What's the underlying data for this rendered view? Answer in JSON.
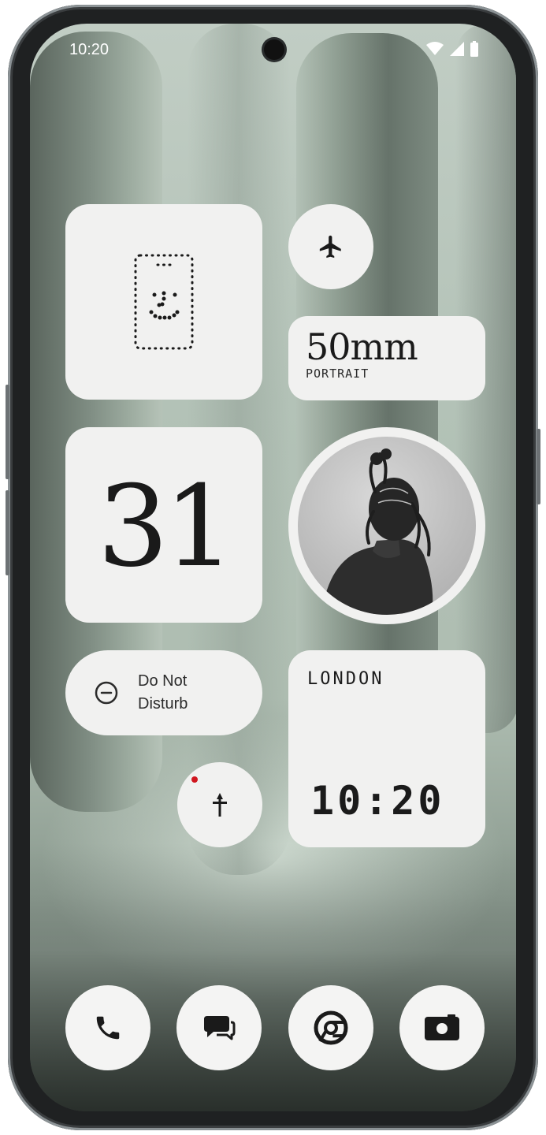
{
  "status_bar": {
    "time": "10:20",
    "icons": [
      "wifi-icon",
      "cellular-signal-icon",
      "battery-icon"
    ]
  },
  "widgets": {
    "face_widget": {
      "icon": "dot-matrix-smiley-phone-icon"
    },
    "airplane_mode": {
      "icon": "airplane-icon"
    },
    "camera_lens": {
      "value": "50mm",
      "mode": "PORTRAIT"
    },
    "date": {
      "day": "31"
    },
    "photo": {
      "subject": "portrait-photo"
    },
    "do_not_disturb": {
      "label_line1": "Do Not",
      "label_line2": "Disturb",
      "icon": "minus-circle-icon"
    },
    "world_clock": {
      "city": "LONDON",
      "time": "10:20"
    },
    "shortcut": {
      "icon": "dagger-shortcut-icon",
      "has_notification": true
    }
  },
  "dock": {
    "apps": [
      "phone-icon",
      "messages-icon",
      "chrome-icon",
      "camera-icon"
    ]
  },
  "colors": {
    "widget_bg": "#f1f1f0",
    "text": "#1a1a1a",
    "notification_dot": "#d0161f",
    "wallpaper_primary": "#aebdb1"
  }
}
